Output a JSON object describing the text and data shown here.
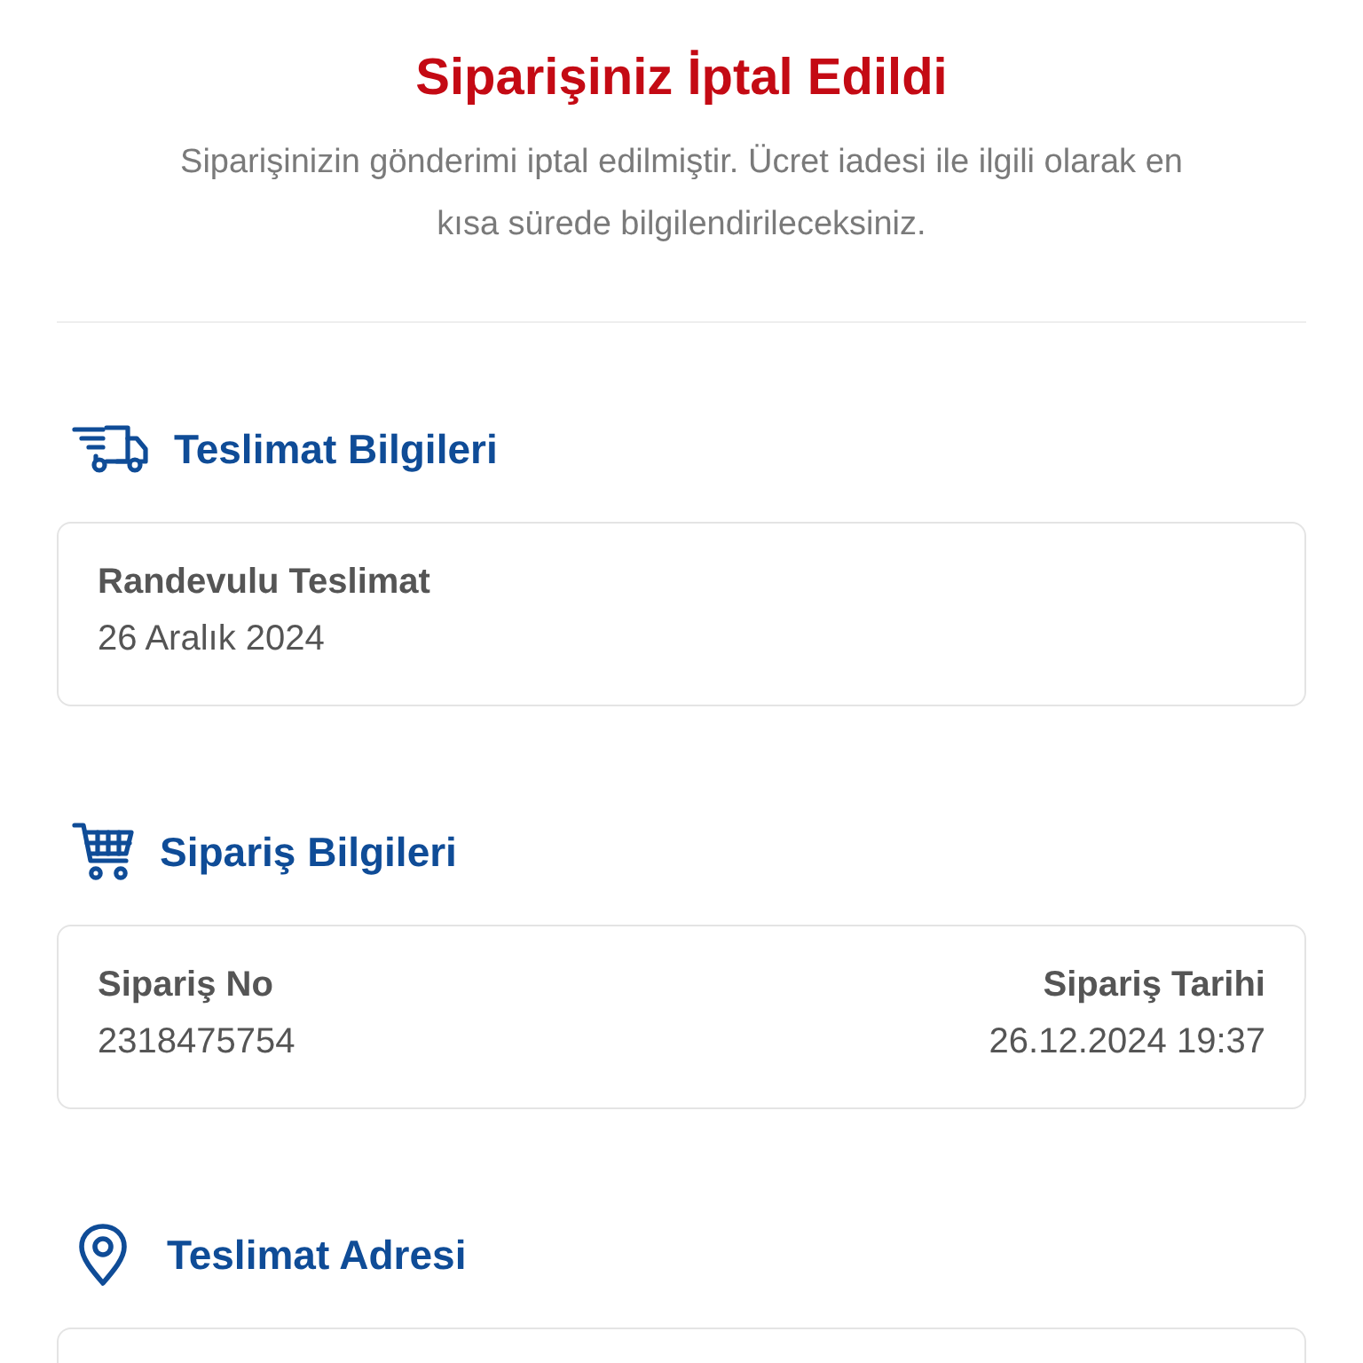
{
  "header": {
    "title": "Siparişiniz İptal Edildi",
    "message": "Siparişinizin gönderimi iptal edilmiştir. Ücret iadesi ile ilgili olarak en kısa sürede bilgilendirileceksiniz."
  },
  "sections": [
    {
      "kind": "delivery",
      "title": "Teslimat Bilgileri",
      "fields": [
        {
          "label": "Randevulu Teslimat",
          "value": "26 Aralık 2024"
        }
      ]
    },
    {
      "kind": "order",
      "title": "Sipariş Bilgileri",
      "fields": [
        {
          "label": "Sipariş No",
          "value": "2318475754"
        },
        {
          "label": "Sipariş Tarihi",
          "value": "26.12.2024 19:37"
        }
      ]
    },
    {
      "kind": "address",
      "title": "Teslimat Adresi"
    }
  ]
}
